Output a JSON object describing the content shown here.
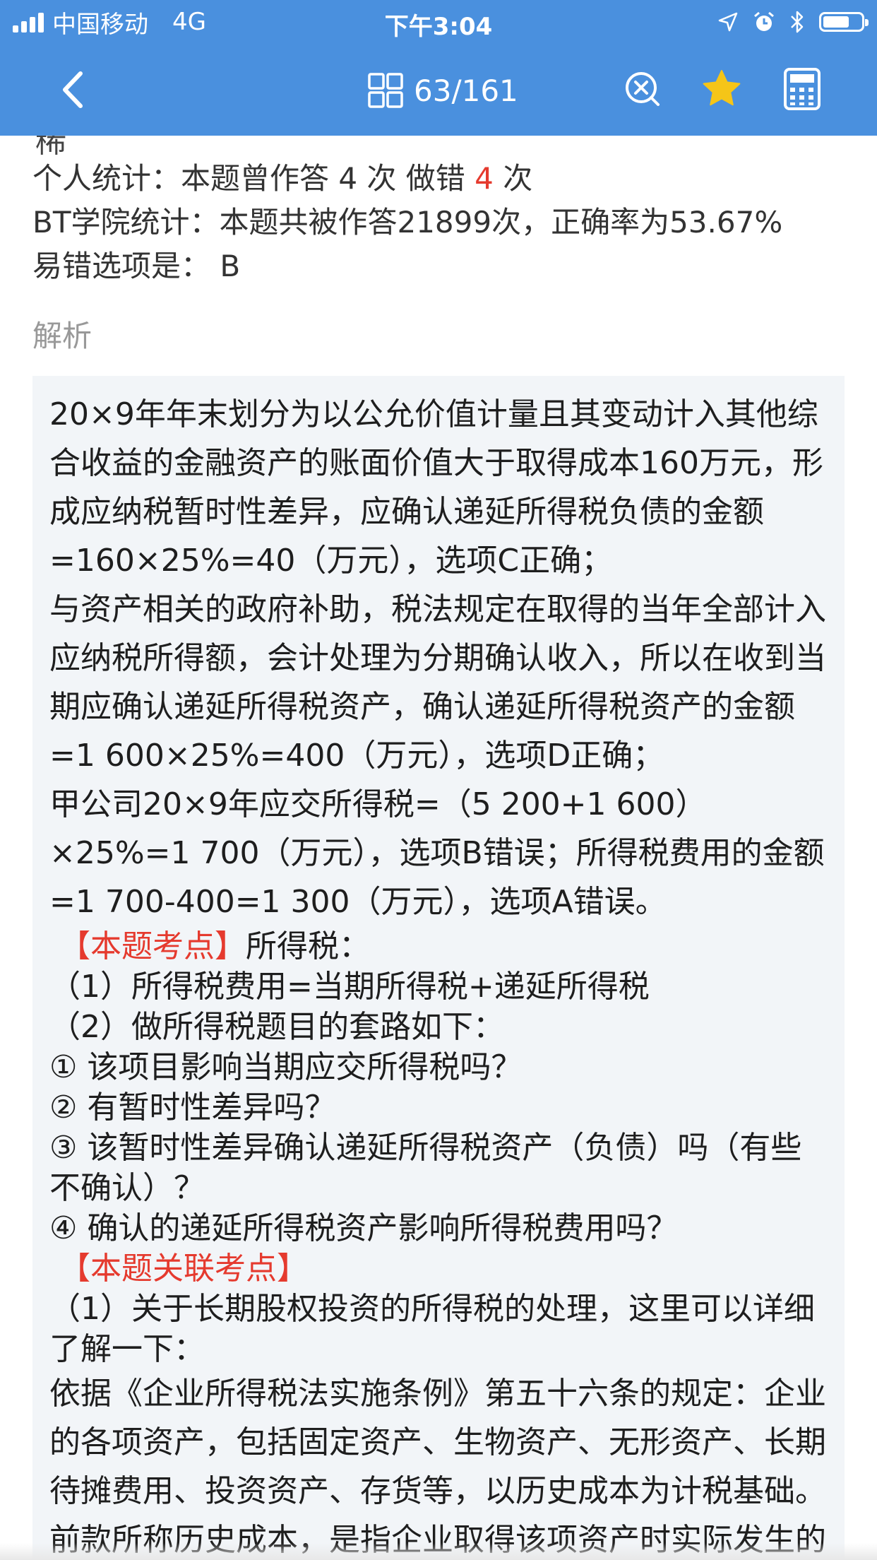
{
  "status_bar": {
    "carrier": "中国移动",
    "network": "4G",
    "time": "下午3:04",
    "battery_level": 0.7
  },
  "navbar": {
    "counter": "63/161",
    "icons": [
      "back-chevron-icon",
      "grid-icon",
      "close-circle-icon",
      "star-icon",
      "calculator-icon"
    ],
    "accent": "#4a90de",
    "star_color": "#f5c518"
  },
  "cut_text": "稀",
  "stats": {
    "personal_prefix": "个人统计：本题曾作答 4 次  做错 ",
    "wrong_count": "4",
    "personal_suffix": " 次",
    "bt_stats": "BT学院统计：本题共被作答21899次，正确率为53.67%",
    "error_option": "易错选项是：  B"
  },
  "section_title": "解析",
  "analysis": {
    "p1": "20×9年年末划分为以公允价值计量且其变动计入其他综合收益的金融资产的账面价值大于取得成本160万元，形成应纳税暂时性差异，应确认递延所得税负债的金额=160×25%=40（万元），选项C正确；",
    "p2": "与资产相关的政府补助，税法规定在取得的当年全部计入应纳税所得额，会计处理为分期确认收入，所以在收到当期应确认递延所得税资产，确认递延所得税资产的金额=1 600×25%=400（万元），选项D正确；",
    "p3": "甲公司20×9年应交所得税=（5 200+1 600）×25%=1 700（万元），选项B错误；所得税费用的金额=1 700-400=1 300（万元），选项A错误。",
    "kp_label": "【本题考点】",
    "kp_text": "所得税：",
    "kp1": "（1）所得税费用=当期所得税+递延所得税",
    "kp2": "（2）做所得税题目的套路如下：",
    "step1": "① 该项目影响当期应交所得税吗？",
    "step2": "② 有暂时性差异吗？",
    "step3": "③ 该暂时性差异确认递延所得税资产（负债）吗（有些不确认）？",
    "step4": "④ 确认的递延所得税资产影响所得税费用吗？",
    "related_label": "【本题关联考点】",
    "related1": "（1）关于长期股权投资的所得税的处理，这里可以详细了解一下：",
    "law": " 依据《企业所得税法实施条例》第五十六条的规定：企业的各项资产，包括固定资产、生物资产、无形资产、长期待摊费用、投资资产、存货等，以历史成本为计税基础。前款所称历史成本，是指企业取得该项资产时实际发生的支出。"
  }
}
